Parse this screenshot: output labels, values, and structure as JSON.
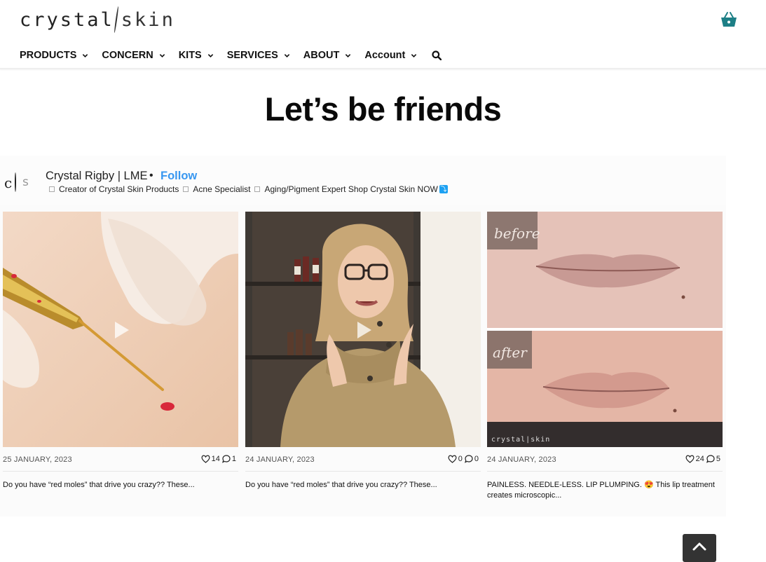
{
  "brand": {
    "logo_left": "crystal",
    "logo_right": "skin",
    "accent": "#1d7f86"
  },
  "nav": {
    "items": [
      {
        "label": "PRODUCTS"
      },
      {
        "label": "CONCERN"
      },
      {
        "label": "KITS"
      },
      {
        "label": "SERVICES"
      },
      {
        "label": "ABOUT"
      },
      {
        "label": "Account"
      }
    ],
    "search_icon": "search-icon"
  },
  "page": {
    "title": "Let’s be friends"
  },
  "instagram": {
    "avatar_left": "c",
    "avatar_right": "s",
    "name": "Crystal Rigby | LME",
    "separator": "•",
    "follow_label": "Follow",
    "bio": [
      "Creator of Crystal Skin Products",
      "Acne Specialist",
      "Aging/Pigment Expert Shop Crystal Skin NOW"
    ],
    "bio_end_icon": "down-arrow-icon",
    "posts": [
      {
        "date": "25 JANUARY, 2023",
        "likes": "14",
        "comments": "1",
        "caption": "Do you have “red moles” that drive you crazy?? These...",
        "type": "video",
        "image": "cautery-tool-on-skin"
      },
      {
        "date": "24 JANUARY, 2023",
        "likes": "0",
        "comments": "0",
        "caption": "Do you have “red moles” that drive you crazy?? These...",
        "type": "video",
        "image": "woman-speaking-in-front-of-product-shelves"
      },
      {
        "date": "24 JANUARY, 2023",
        "likes": "24",
        "comments": "5",
        "caption": "PAINLESS. NEEDLE-LESS. LIP PLUMPING. 😍 This lip treatment creates microscopic...",
        "type": "image",
        "image": "lips-before-after",
        "label_before": "before",
        "label_after": "after",
        "watermark": "crystal|skin"
      }
    ]
  }
}
